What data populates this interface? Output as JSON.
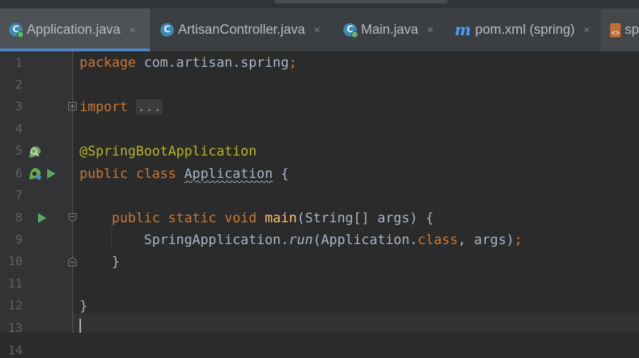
{
  "tabs": [
    {
      "label": "Application.java",
      "icon": "class-icon",
      "active": true
    },
    {
      "label": "ArtisanController.java",
      "icon": "class-icon",
      "active": false
    },
    {
      "label": "Main.java",
      "icon": "class-icon",
      "active": false
    },
    {
      "label": "pom.xml (spring)",
      "icon": "maven-icon",
      "active": false
    },
    {
      "label": "sp",
      "icon": "xml-icon",
      "active": false
    }
  ],
  "close_glyph": "×",
  "icon_letters": {
    "class": "C",
    "maven": "m",
    "xml": "<>"
  },
  "line_numbers": [
    "1",
    "2",
    "3",
    "4",
    "5",
    "6",
    "7",
    "8",
    "9",
    "10",
    "11",
    "12",
    "13",
    "14"
  ],
  "code": {
    "l1": {
      "kw": "package",
      "rest": " com.artisan.spring",
      "semi": ";"
    },
    "l3": {
      "kw": "import",
      "fold": "..."
    },
    "l6": {
      "annotation": "@SpringBootApplication"
    },
    "l7": {
      "kw": "public class",
      "name": "Application",
      "rest": " {"
    },
    "l9": {
      "indent": "    ",
      "kw": "public static void",
      "method": "main",
      "rest": "(String[] args) {"
    },
    "l10": {
      "indent": "        ",
      "a": "SpringApplication.",
      "call": "run",
      "b": "(Application.",
      "kw": "class",
      "c": ", args)",
      "semi": ";"
    },
    "l11": {
      "text": "    }"
    },
    "l13": {
      "text": "}"
    }
  },
  "colors": {
    "keyword": "#cc7832",
    "annotation": "#bbb529",
    "method": "#ffc66d",
    "text": "#a9b7c6",
    "accent": "#4a88c7"
  }
}
